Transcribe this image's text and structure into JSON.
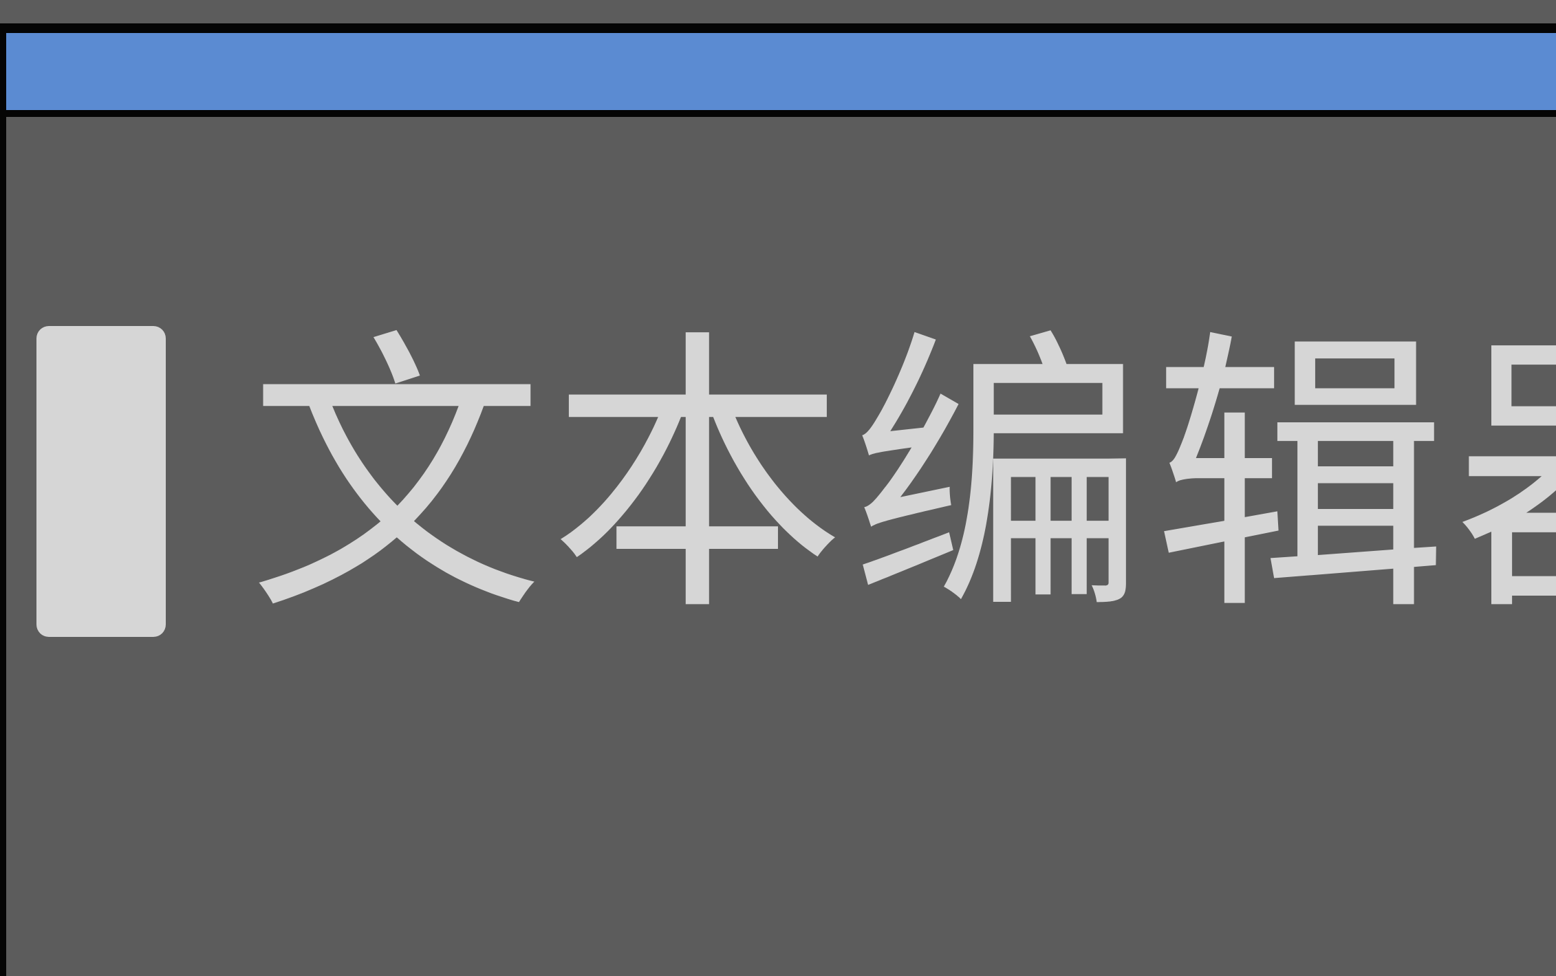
{
  "title_bar": {
    "accent_color": "#5b8bd2"
  },
  "editor": {
    "background_color": "#5c5c5c",
    "text": "文本编辑器",
    "text_color": "#d6d6d6",
    "caret": "block-cursor"
  }
}
